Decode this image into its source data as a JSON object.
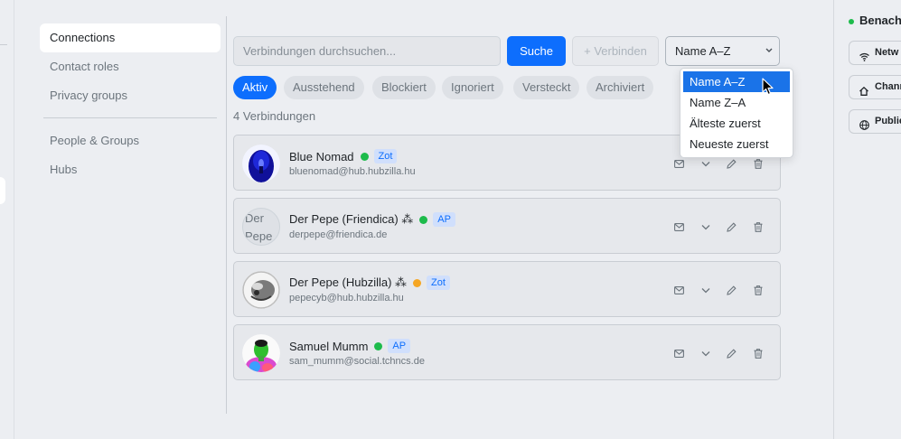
{
  "sidebar": {
    "items": [
      {
        "label": "Connections",
        "active": true
      },
      {
        "label": "Contact roles"
      },
      {
        "label": "Privacy groups"
      }
    ],
    "items2": [
      {
        "label": "People & Groups"
      },
      {
        "label": "Hubs"
      }
    ]
  },
  "toolbar": {
    "search_placeholder": "Verbindungen durchsuchen...",
    "search_button": "Suche",
    "connect_button": "+ Verbinden",
    "sort_value": "Name A–Z"
  },
  "filters": [
    "Aktiv",
    "Ausstehend",
    "Blockiert",
    "Ignoriert",
    "Versteckt",
    "Archiviert"
  ],
  "count_text": "4 Verbindungen",
  "connections": [
    {
      "name": "Blue Nomad",
      "status": "online",
      "protocol": "Zot",
      "handle": "bluenomad@hub.hubzilla.hu"
    },
    {
      "name": "Der Pepe (Friendica) ⁂",
      "status": "online",
      "protocol": "AP",
      "handle": "derpepe@friendica.de",
      "avatar_text": "Der Pepe"
    },
    {
      "name": "Der Pepe (Hubzilla) ⁂",
      "status": "away",
      "protocol": "Zot",
      "handle": "pepecyb@hub.hubzilla.hu"
    },
    {
      "name": "Samuel Mumm",
      "status": "online",
      "protocol": "AP",
      "handle": "sam_mumm@social.tchncs.de"
    }
  ],
  "sort_options": [
    "Name A–Z",
    "Name Z–A",
    "Älteste zuerst",
    "Neueste zuerst"
  ],
  "right_panel": {
    "title": "Benach",
    "buttons": [
      {
        "label": "Netw",
        "icon": "wifi-icon"
      },
      {
        "label": "Chann",
        "icon": "home-icon"
      },
      {
        "label": "Public",
        "icon": "globe-icon"
      }
    ]
  },
  "colors": {
    "accent": "#0d6efd",
    "online": "#1dbb4b",
    "away": "#f5a623",
    "selected_option": "#1a73e8"
  }
}
